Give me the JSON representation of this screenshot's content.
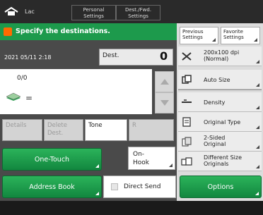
{
  "topbar": {
    "home_label": "Lac",
    "personal_settings": "Personal\nSettings",
    "shared_settings": "Dest./Fwd.\nSettings"
  },
  "header": {
    "title": "Specify the destinations."
  },
  "status": {
    "datetime": "2021 05/11 2:18",
    "dest_label": "Dest.",
    "dest_count": "0"
  },
  "list": {
    "count": "0/0"
  },
  "row_buttons": {
    "details": "Details",
    "delete": "Delete\nDest.",
    "tone": "Tone",
    "r": "R"
  },
  "buttons": {
    "one_touch": "One-Touch",
    "on_hook": "On-\nHook",
    "address_book": "Address Book",
    "direct_send": "Direct Send",
    "options": "Options"
  },
  "right_panel": {
    "previous_settings": "Previous\nSettings",
    "favorite_settings": "Favorite\nSettings",
    "items": [
      {
        "label": "200x100 dpi\n(Normal)",
        "icon": "resolution-icon"
      },
      {
        "label": "Auto Size",
        "icon": "copy-size-icon"
      },
      {
        "label": "Density",
        "icon": "density-icon"
      },
      {
        "label": "Original Type",
        "icon": "original-type-icon"
      },
      {
        "label": "2-Sided\nOriginal",
        "icon": "two-sided-icon"
      },
      {
        "label": "Different Size\nOriginals",
        "icon": "different-size-icon"
      }
    ]
  },
  "colors": {
    "accent_green": "#1d9a4c",
    "alert_orange": "#ff6a00"
  }
}
